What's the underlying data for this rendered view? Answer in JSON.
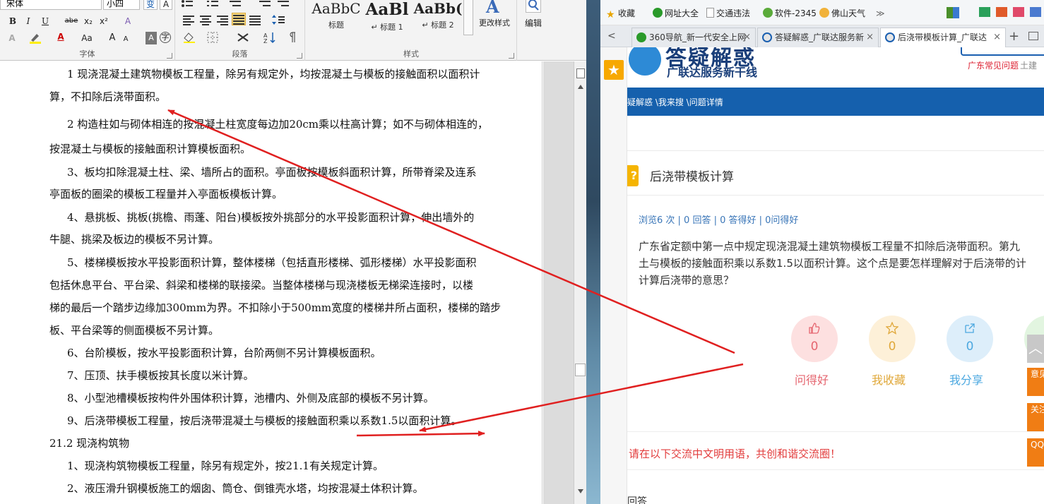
{
  "word": {
    "ribbon": {
      "font_name": "宋体",
      "font_size": "小四",
      "font_group_label": "字体",
      "paragraph_group_label": "段落",
      "styles_group_label": "样式",
      "styles": [
        {
          "sample": "AaBbC",
          "name": "标题"
        },
        {
          "sample": "AaBl",
          "name": "↵ 标题 1"
        },
        {
          "sample": "AaBb(",
          "name": "↵ 标题 2"
        }
      ],
      "change_styles_label": "更改样式",
      "edit_label": "编辑",
      "buttons": {
        "bold": "B",
        "italic": "I",
        "underline": "U",
        "strike": "abe",
        "subscript": "x₂",
        "superscript": "x²",
        "clear": "A",
        "font_color": "A",
        "change_case": "Aa",
        "grow": "A",
        "shrink": "A"
      }
    },
    "paragraphs": [
      "1 现浇混凝土建筑物模板工程量，除另有规定外，均按混凝土与模板的接触面积以面积计",
      "算，不扣除后浇带面积。",
      "2 构造柱如与砌体相连的按混凝土柱宽度每边加20cm乘以柱高计算；如不与砌体相连的，",
      "按混凝土与模板的接触面积计算模板面积。",
      "3、板均扣除混凝土柱、梁、墙所占的面积。亭面板按模板斜面积计算，所带脊梁及连系",
      "亭面板的圈梁的模板工程量并入亭面板模板计算。",
      "4、悬挑板、挑板(挑檐、雨蓬、阳台)模板按外挑部分的水平投影面积计算，伸出墙外的",
      "牛腿、挑梁及板边的模板不另计算。",
      "5、楼梯模板按水平投影面积计算，整体楼梯（包括直形楼梯、弧形楼梯）水平投影面积",
      "包括休息平台、平台梁、斜梁和楼梯的联接梁。当整体楼梯与现浇楼板无梯梁连接时，以楼",
      "梯的最后一个踏步边缘加300mm为界。不扣除小于500mm宽度的楼梯井所占面积，楼梯的踏步",
      "板、平台梁等的侧面模板不另计算。",
      "6、台阶模板，按水平投影面积计算，台阶两侧不另计算模板面积。",
      "7、压顶、扶手模板按其长度以米计算。",
      "8、小型池槽模板按构件外围体积计算，池槽内、外侧及底部的模板不另计算。",
      "9、后浇带模板工程量，按后浇带混凝土与模板的接触面积乘以系数1.5以面积计算。",
      "21.2 现浇构筑物",
      "1、现浇构筑物模板工程量，除另有规定外，按21.1有关规定计算。",
      "2、液压滑升钢模板施工的烟囱、筒仓、倒锥壳水塔，均按混凝土体积计算。"
    ]
  },
  "browser": {
    "bookmarks": [
      "收藏",
      "网址大全",
      "交通违法",
      "软件-2345",
      "佛山天气",
      "≫"
    ],
    "tabs": [
      {
        "title": "360导航_新一代安全上网",
        "active": false
      },
      {
        "title": "答疑解惑_广联达服务新",
        "active": false
      },
      {
        "title": "后浇带模板计算_广联达",
        "active": true
      }
    ],
    "new_tab": "+",
    "site": {
      "logo_text": "答疑解惑",
      "slogan": "广联达服务新干线",
      "top_link_1": "广东常见问题",
      "top_link_2": "土建",
      "breadcrumb": "疑解惑 \\我来搜 \\问题详情"
    },
    "question": {
      "title": "后浇带模板计算",
      "stats": "浏览6 次 | 0 回答 | 0 答得好 | 0问得好",
      "body_lines": [
        "广东省定额中第一点中规定现浇混凝土建筑物模板工程量不扣除后浇带面积。第九",
        "土与模板的接触面积乘以系数1.5以面积计算。这个点是要怎样理解对于后浇带的计",
        "计算后浇带的意思？"
      ],
      "actions": [
        {
          "label": "问得好",
          "count": "0"
        },
        {
          "label": "我收藏",
          "count": "0"
        },
        {
          "label": "我分享",
          "count": "0"
        }
      ],
      "comment_hint": "请在以下交流中文明用语，共创和谐交流圈！",
      "answer_label": "回答"
    },
    "side_buttons": [
      "意见反馈",
      "关注我们",
      "QQ咨询"
    ],
    "colors": {
      "nav_blue": "#1560ad",
      "accent_orange": "#f07d14",
      "annotation_red": "#e02020"
    }
  }
}
